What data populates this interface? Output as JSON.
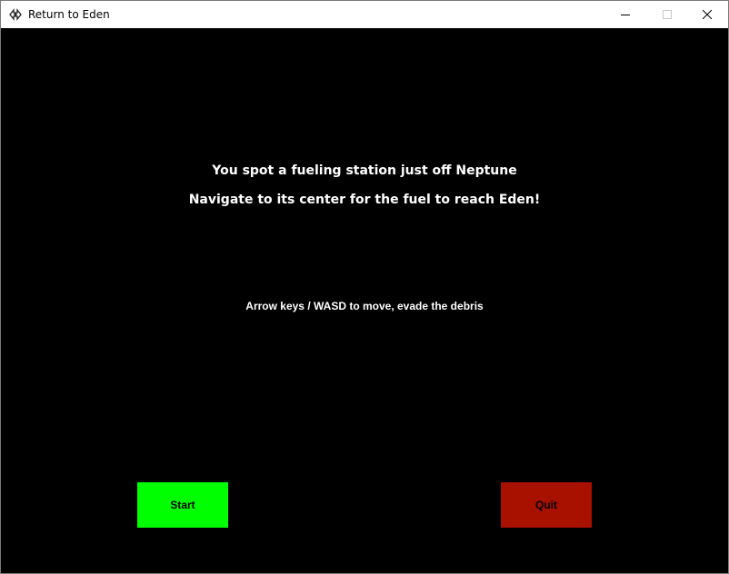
{
  "window": {
    "title": "Return to Eden",
    "controls": [
      "minimize-icon",
      "maximize-icon",
      "close-icon"
    ]
  },
  "intro": {
    "line1": "You spot a fueling station just off Neptune",
    "line2": "Navigate to its center for the fuel to reach Eden!",
    "controls_hint": "Arrow keys / WASD to move, evade the debris"
  },
  "buttons": {
    "start_label": "Start",
    "quit_label": "Quit"
  },
  "colors": {
    "background": "#000000",
    "text": "#ffffff",
    "start_button": "#00ff00",
    "quit_button": "#a81000"
  }
}
